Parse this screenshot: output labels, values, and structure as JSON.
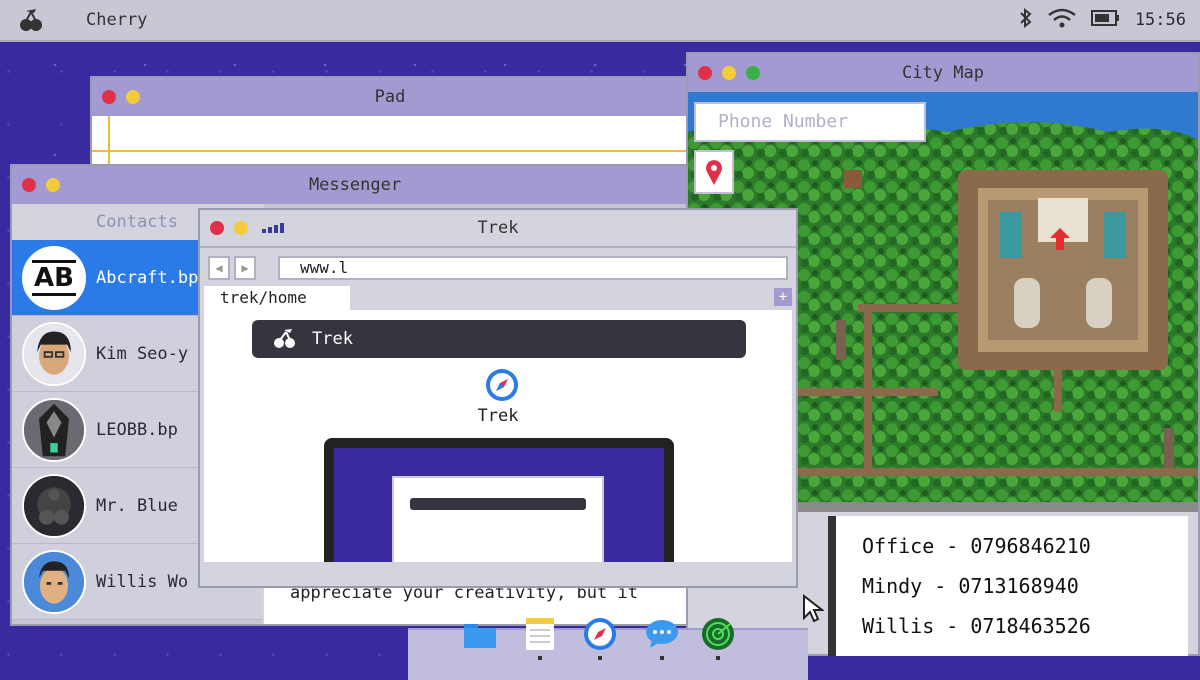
{
  "menubar": {
    "app_name": "Cherry",
    "time": "15:56"
  },
  "pad": {
    "title": "Pad"
  },
  "messenger": {
    "title": "Messenger",
    "contacts_header": "Contacts",
    "contacts": [
      {
        "name": "Abcraft.bp",
        "avatar_text": "AB"
      },
      {
        "name": "Kim Seo-y"
      },
      {
        "name": "LEOBB.bp"
      },
      {
        "name": "Mr. Blue"
      },
      {
        "name": "Willis Wo"
      }
    ],
    "chat_message": "Thank you for this latest draft. I appreciate your creativity, but it"
  },
  "city_map": {
    "title": "City Map",
    "phone_placeholder": "Phone Number",
    "phone_numbers": [
      "Office - 0796846210",
      "Mindy - 0713168940",
      "Willis - 0718463526"
    ]
  },
  "trek": {
    "title": "Trek",
    "url": "www.l",
    "tab_label": "trek/home",
    "new_tab_label": "+",
    "header_label": "Trek",
    "app_label": "Trek"
  },
  "colors": {
    "accent": "#2a7ae8",
    "titlebar": "#a49ad2",
    "desktop": "#3a2aa0"
  },
  "dock": {
    "items": [
      "folder-icon",
      "notes-icon",
      "compass-icon",
      "chat-icon",
      "radar-icon"
    ]
  }
}
